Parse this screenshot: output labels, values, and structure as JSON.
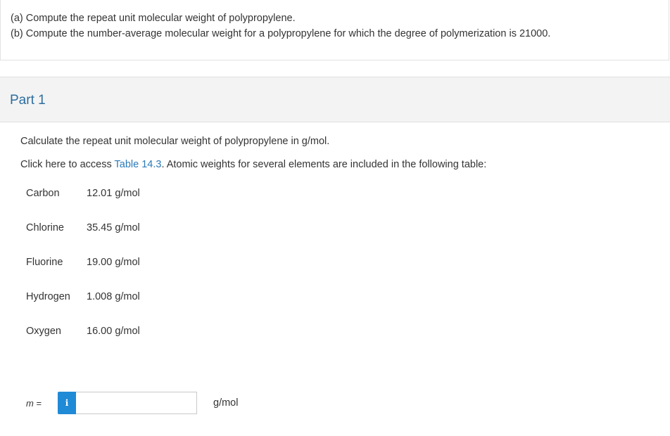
{
  "problem": {
    "a_prefix": "(a)",
    "a_text": " Compute the repeat unit molecular weight of polypropylene.",
    "b_prefix": "(b)",
    "b_text": " Compute the number-average molecular weight for a polypropylene for which the degree of polymerization is 21000."
  },
  "part": {
    "title": "Part 1"
  },
  "question": {
    "text": "Calculate the repeat unit molecular weight of polypropylene in g/mol.",
    "access_prefix": "Click here to access ",
    "access_link": "Table 14.3",
    "access_suffix": ". Atomic weights for several elements are included in the following table:"
  },
  "elements": [
    {
      "name": "Carbon",
      "weight": "12.01 g/mol"
    },
    {
      "name": "Chlorine",
      "weight": "35.45 g/mol"
    },
    {
      "name": "Fluorine",
      "weight": "19.00 g/mol"
    },
    {
      "name": "Hydrogen",
      "weight": "1.008 g/mol"
    },
    {
      "name": "Oxygen",
      "weight": "16.00 g/mol"
    }
  ],
  "answer": {
    "label_var": "m",
    "label_eq": " =",
    "info_icon": "i",
    "value": "",
    "unit": "g/mol"
  },
  "colors": {
    "accent": "#1f8ad6",
    "part_title": "#2c6d9e",
    "link": "#2a7ab8",
    "header_bg": "#f3f3f3"
  }
}
